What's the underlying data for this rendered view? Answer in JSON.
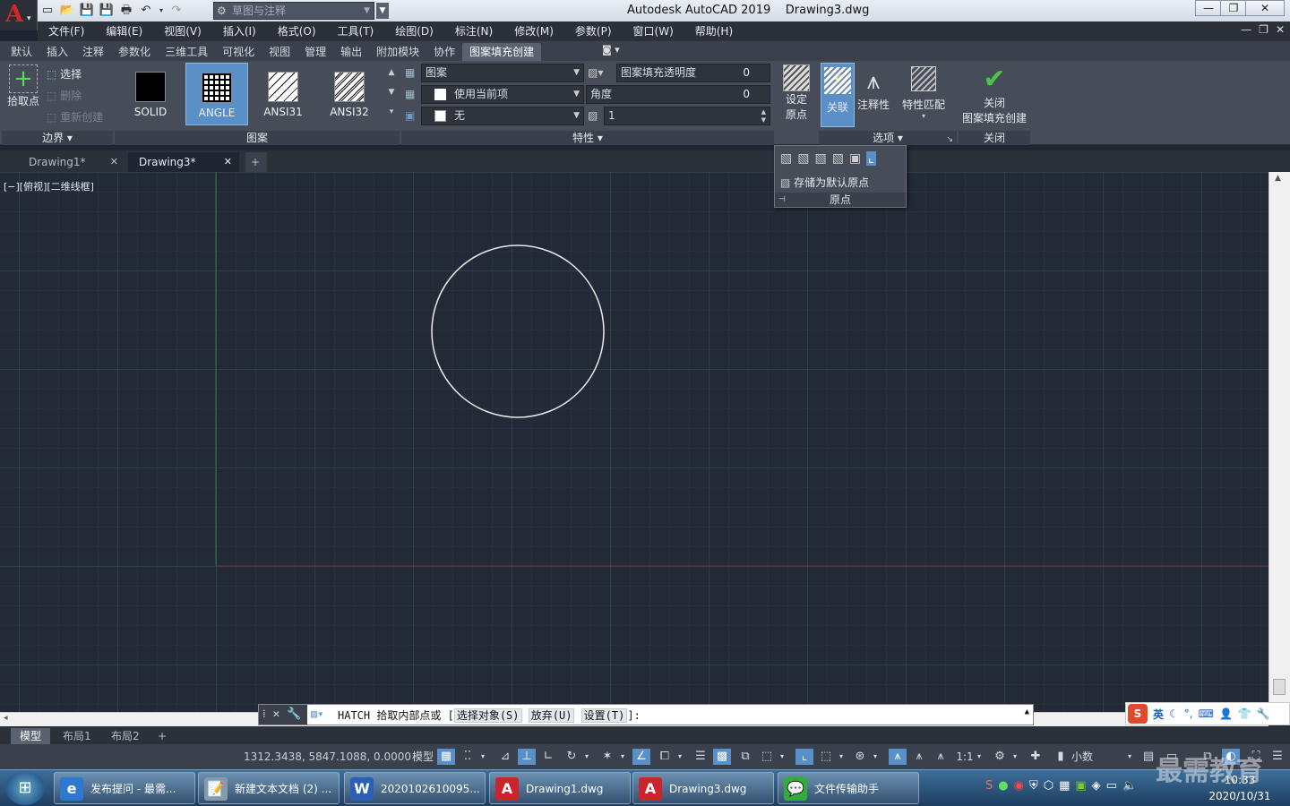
{
  "window": {
    "app_title": "Autodesk AutoCAD 2019",
    "doc_title": "Drawing3.dwg",
    "min": "—",
    "max": "❐",
    "close": "✕"
  },
  "qat": {
    "workspace": "草图与注释"
  },
  "menu": [
    "文件(F)",
    "编辑(E)",
    "视图(V)",
    "插入(I)",
    "格式(O)",
    "工具(T)",
    "绘图(D)",
    "标注(N)",
    "修改(M)",
    "参数(P)",
    "窗口(W)",
    "帮助(H)"
  ],
  "ribbon_tabs": [
    "默认",
    "插入",
    "注释",
    "参数化",
    "三维工具",
    "可视化",
    "视图",
    "管理",
    "输出",
    "附加模块",
    "协作",
    "图案填充创建"
  ],
  "ribbon_active_tab": "图案填充创建",
  "boundary": {
    "pick": "拾取点",
    "select": "选择",
    "remove": "删除",
    "recreate": "重新创建",
    "label": "边界 ▾"
  },
  "pattern": {
    "label": "图案",
    "items": [
      "SOLID",
      "ANGLE",
      "ANSI31",
      "ANSI32"
    ],
    "active": "ANGLE"
  },
  "properties": {
    "type": "图案",
    "color": "使用当前项",
    "bg": "无",
    "transparency_label": "图案填充透明度",
    "transparency": "0",
    "angle_label": "角度",
    "angle": "0",
    "scale": "1",
    "label": "特性 ▾"
  },
  "origin": {
    "set": "设定",
    "set2": "原点",
    "store": "存储为默认原点",
    "label": "原点"
  },
  "options": {
    "assoc": "关联",
    "annotative": "注释性",
    "match": "特性匹配",
    "label": "选项 ▾"
  },
  "close_panel": {
    "line1": "关闭",
    "line2": "图案填充创建",
    "label": "关闭"
  },
  "doc_tabs": [
    "Drawing1*",
    "Drawing3*"
  ],
  "view_label": "[−][俯视][二维线框]",
  "command": {
    "cmd": "HATCH",
    "prompt": "拾取内部点或",
    "opt1": "选择对象(S)",
    "opt2": "放弃(U)",
    "opt3": "设置(T)",
    "end": "]:"
  },
  "layout_tabs": [
    "模型",
    "布局1",
    "布局2"
  ],
  "status": {
    "coords": "1312.3438, 5847.1088, 0.0000",
    "model": "模型",
    "scale": "1:1",
    "units": "小数"
  },
  "taskbar": [
    {
      "label": "发布提问 - 最需...",
      "icon": "e"
    },
    {
      "label": "新建文本文档 (2) ...",
      "icon": "📝"
    },
    {
      "label": "2020102610095...",
      "icon": "W"
    },
    {
      "label": "Drawing1.dwg",
      "icon": "A"
    },
    {
      "label": "Drawing3.dwg",
      "icon": "A"
    },
    {
      "label": "文件传输助手",
      "icon": "💬"
    }
  ],
  "tray": {
    "ime": "英",
    "time": "10:33",
    "date": "2020/10/31"
  },
  "watermark": "最需教育"
}
